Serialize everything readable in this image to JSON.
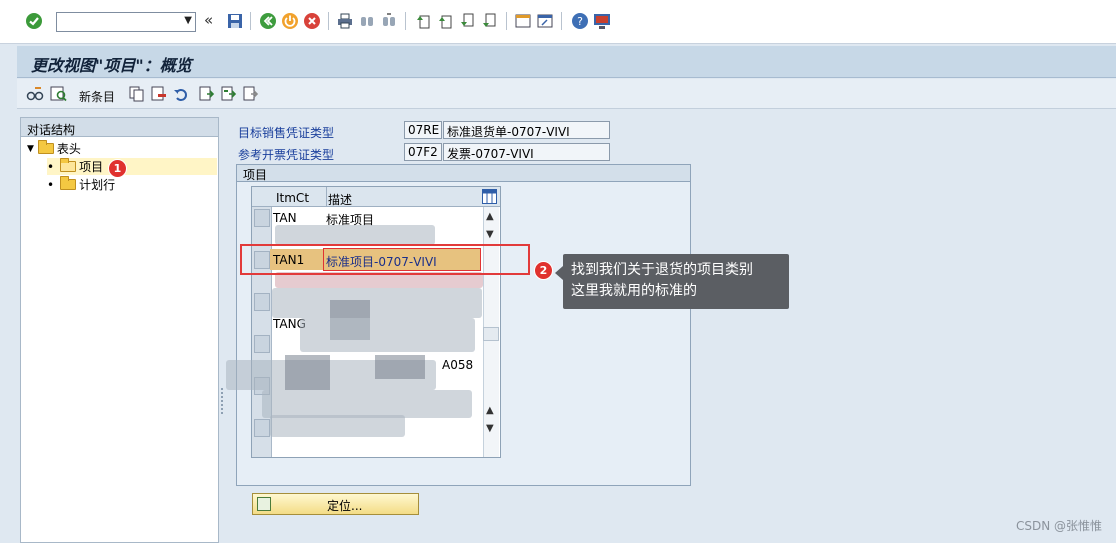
{
  "sys_toolbar": {
    "command_value": ""
  },
  "title": "更改视图\"项目\"：概览",
  "app_toolbar": {
    "new_entries": "新条目"
  },
  "tree": {
    "header": "对话结构",
    "items": [
      {
        "label": "表头"
      },
      {
        "label": "项目",
        "badge": "1"
      },
      {
        "label": "计划行"
      }
    ]
  },
  "fields": [
    {
      "label": "目标销售凭证类型",
      "code": "07RE",
      "desc": "标准退货单-0707-VIVI"
    },
    {
      "label": "参考开票凭证类型",
      "code": "07F2",
      "desc": "发票-0707-VIVI"
    }
  ],
  "group": {
    "title": "项目",
    "columns": [
      "ItmCt",
      "描述"
    ],
    "rows": [
      {
        "itmct": "TAN",
        "desc": "标准项目"
      },
      {
        "itmct": "TAN1",
        "desc": "标准项目-0707-VIVI"
      },
      {
        "itmct": "TANG",
        "desc": ""
      },
      {
        "itmct": "",
        "desc": "A058"
      }
    ]
  },
  "annotation": {
    "badge": "2",
    "line1": "找到我们关于退货的项目类别",
    "line2": "这里我就用的标准的"
  },
  "position_button": "定位...",
  "watermark": "CSDN @张惟惟",
  "colors": {
    "highlight": "#e7c27f",
    "annotation_red": "#e23a3a",
    "callout_bg": "#5b5e63"
  }
}
